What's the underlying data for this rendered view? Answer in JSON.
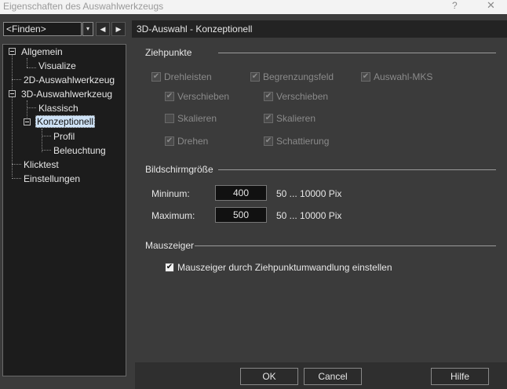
{
  "window": {
    "title": "Eigenschaften des Auswahlwerkzeugs",
    "help_glyph": "?",
    "close_glyph": "✕"
  },
  "find": {
    "value": "<Finden>",
    "arrow_glyph": "▾",
    "prev_glyph": "◀",
    "next_glyph": "▶"
  },
  "tree": {
    "items": [
      {
        "label": "Allgemein"
      },
      {
        "label": "Visualize"
      },
      {
        "label": "2D-Auswahlwerkzeug"
      },
      {
        "label": "3D-Auswahlwerkzeug"
      },
      {
        "label": "Klassisch"
      },
      {
        "label": "Konzeptionell",
        "selected": true
      },
      {
        "label": "Profil"
      },
      {
        "label": "Beleuchtung"
      },
      {
        "label": "Klicktest"
      },
      {
        "label": "Einstellungen"
      }
    ]
  },
  "page": {
    "title": "3D-Auswahl - Konzeptionell",
    "ziehpunkte": {
      "label": "Ziehpunkte",
      "checks": [
        {
          "label": "Drehleisten",
          "checked": true,
          "enabled": false
        },
        {
          "label": "Begrenzungsfeld",
          "checked": true,
          "enabled": false
        },
        {
          "label": "Auswahl-MKS",
          "checked": true,
          "enabled": false
        },
        {
          "label": "Verschieben",
          "checked": true,
          "enabled": false
        },
        {
          "label": "Verschieben",
          "checked": true,
          "enabled": false
        },
        {
          "label": "Skalieren",
          "checked": false,
          "enabled": false
        },
        {
          "label": "Skalieren",
          "checked": true,
          "enabled": false
        },
        {
          "label": "Drehen",
          "checked": true,
          "enabled": false
        },
        {
          "label": "Schattierung",
          "checked": true,
          "enabled": false
        }
      ]
    },
    "bildschirmgroesse": {
      "label": "Bildschirmgröße",
      "min_label": "Mininum:",
      "min_value": "400",
      "min_range": "50 ... 10000 Pix",
      "max_label": "Maximum:",
      "max_value": "500",
      "max_range": "50 ... 10000 Pix"
    },
    "mauszeiger": {
      "label": "Mauszeiger",
      "check_label": "Mauszeiger durch Ziehpunktumwandlung einstellen",
      "checked": true
    },
    "check_glyph": "✔"
  },
  "buttons": {
    "ok": "OK",
    "cancel": "Cancel",
    "help": "Hilfe"
  },
  "colors": {
    "background": "#3b3b3b",
    "tree_background": "#1c1c1c",
    "selection": "#cfe3f7"
  }
}
